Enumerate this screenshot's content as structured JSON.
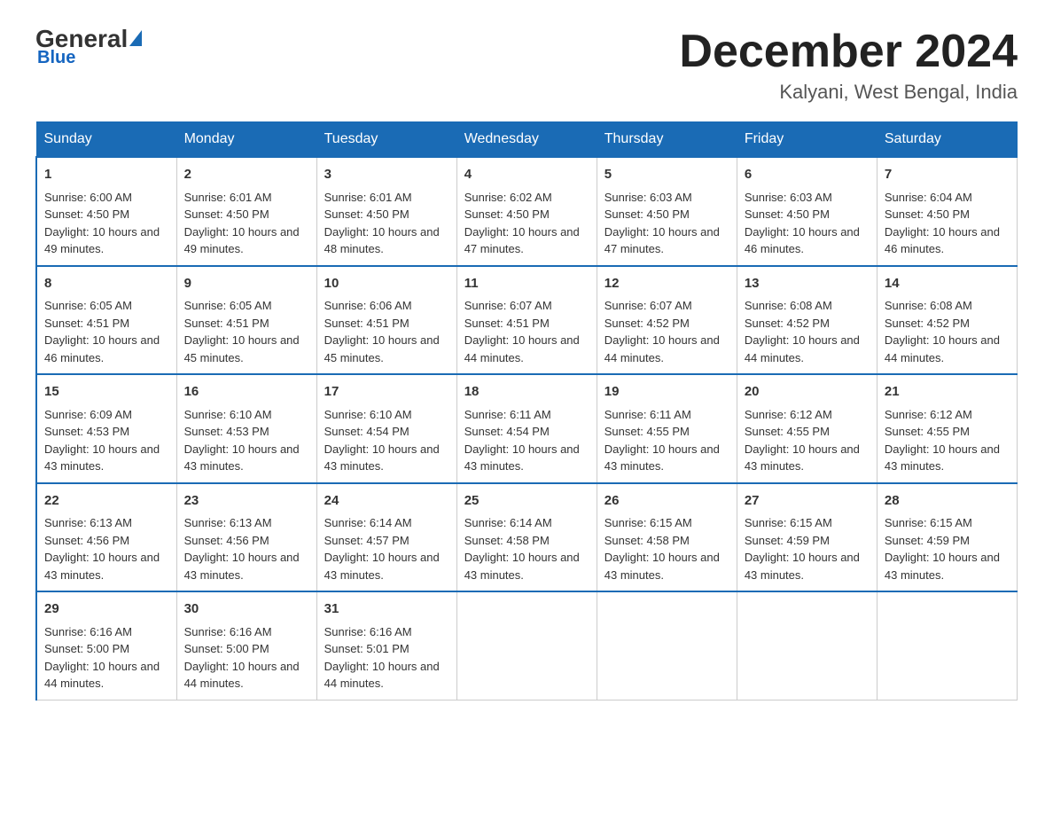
{
  "logo": {
    "general": "General",
    "blue": "Blue"
  },
  "header": {
    "month": "December 2024",
    "location": "Kalyani, West Bengal, India"
  },
  "weekdays": [
    "Sunday",
    "Monday",
    "Tuesday",
    "Wednesday",
    "Thursday",
    "Friday",
    "Saturday"
  ],
  "weeks": [
    [
      {
        "day": "1",
        "sunrise": "6:00 AM",
        "sunset": "4:50 PM",
        "daylight": "10 hours and 49 minutes."
      },
      {
        "day": "2",
        "sunrise": "6:01 AM",
        "sunset": "4:50 PM",
        "daylight": "10 hours and 49 minutes."
      },
      {
        "day": "3",
        "sunrise": "6:01 AM",
        "sunset": "4:50 PM",
        "daylight": "10 hours and 48 minutes."
      },
      {
        "day": "4",
        "sunrise": "6:02 AM",
        "sunset": "4:50 PM",
        "daylight": "10 hours and 47 minutes."
      },
      {
        "day": "5",
        "sunrise": "6:03 AM",
        "sunset": "4:50 PM",
        "daylight": "10 hours and 47 minutes."
      },
      {
        "day": "6",
        "sunrise": "6:03 AM",
        "sunset": "4:50 PM",
        "daylight": "10 hours and 46 minutes."
      },
      {
        "day": "7",
        "sunrise": "6:04 AM",
        "sunset": "4:50 PM",
        "daylight": "10 hours and 46 minutes."
      }
    ],
    [
      {
        "day": "8",
        "sunrise": "6:05 AM",
        "sunset": "4:51 PM",
        "daylight": "10 hours and 46 minutes."
      },
      {
        "day": "9",
        "sunrise": "6:05 AM",
        "sunset": "4:51 PM",
        "daylight": "10 hours and 45 minutes."
      },
      {
        "day": "10",
        "sunrise": "6:06 AM",
        "sunset": "4:51 PM",
        "daylight": "10 hours and 45 minutes."
      },
      {
        "day": "11",
        "sunrise": "6:07 AM",
        "sunset": "4:51 PM",
        "daylight": "10 hours and 44 minutes."
      },
      {
        "day": "12",
        "sunrise": "6:07 AM",
        "sunset": "4:52 PM",
        "daylight": "10 hours and 44 minutes."
      },
      {
        "day": "13",
        "sunrise": "6:08 AM",
        "sunset": "4:52 PM",
        "daylight": "10 hours and 44 minutes."
      },
      {
        "day": "14",
        "sunrise": "6:08 AM",
        "sunset": "4:52 PM",
        "daylight": "10 hours and 44 minutes."
      }
    ],
    [
      {
        "day": "15",
        "sunrise": "6:09 AM",
        "sunset": "4:53 PM",
        "daylight": "10 hours and 43 minutes."
      },
      {
        "day": "16",
        "sunrise": "6:10 AM",
        "sunset": "4:53 PM",
        "daylight": "10 hours and 43 minutes."
      },
      {
        "day": "17",
        "sunrise": "6:10 AM",
        "sunset": "4:54 PM",
        "daylight": "10 hours and 43 minutes."
      },
      {
        "day": "18",
        "sunrise": "6:11 AM",
        "sunset": "4:54 PM",
        "daylight": "10 hours and 43 minutes."
      },
      {
        "day": "19",
        "sunrise": "6:11 AM",
        "sunset": "4:55 PM",
        "daylight": "10 hours and 43 minutes."
      },
      {
        "day": "20",
        "sunrise": "6:12 AM",
        "sunset": "4:55 PM",
        "daylight": "10 hours and 43 minutes."
      },
      {
        "day": "21",
        "sunrise": "6:12 AM",
        "sunset": "4:55 PM",
        "daylight": "10 hours and 43 minutes."
      }
    ],
    [
      {
        "day": "22",
        "sunrise": "6:13 AM",
        "sunset": "4:56 PM",
        "daylight": "10 hours and 43 minutes."
      },
      {
        "day": "23",
        "sunrise": "6:13 AM",
        "sunset": "4:56 PM",
        "daylight": "10 hours and 43 minutes."
      },
      {
        "day": "24",
        "sunrise": "6:14 AM",
        "sunset": "4:57 PM",
        "daylight": "10 hours and 43 minutes."
      },
      {
        "day": "25",
        "sunrise": "6:14 AM",
        "sunset": "4:58 PM",
        "daylight": "10 hours and 43 minutes."
      },
      {
        "day": "26",
        "sunrise": "6:15 AM",
        "sunset": "4:58 PM",
        "daylight": "10 hours and 43 minutes."
      },
      {
        "day": "27",
        "sunrise": "6:15 AM",
        "sunset": "4:59 PM",
        "daylight": "10 hours and 43 minutes."
      },
      {
        "day": "28",
        "sunrise": "6:15 AM",
        "sunset": "4:59 PM",
        "daylight": "10 hours and 43 minutes."
      }
    ],
    [
      {
        "day": "29",
        "sunrise": "6:16 AM",
        "sunset": "5:00 PM",
        "daylight": "10 hours and 44 minutes."
      },
      {
        "day": "30",
        "sunrise": "6:16 AM",
        "sunset": "5:00 PM",
        "daylight": "10 hours and 44 minutes."
      },
      {
        "day": "31",
        "sunrise": "6:16 AM",
        "sunset": "5:01 PM",
        "daylight": "10 hours and 44 minutes."
      },
      null,
      null,
      null,
      null
    ]
  ]
}
